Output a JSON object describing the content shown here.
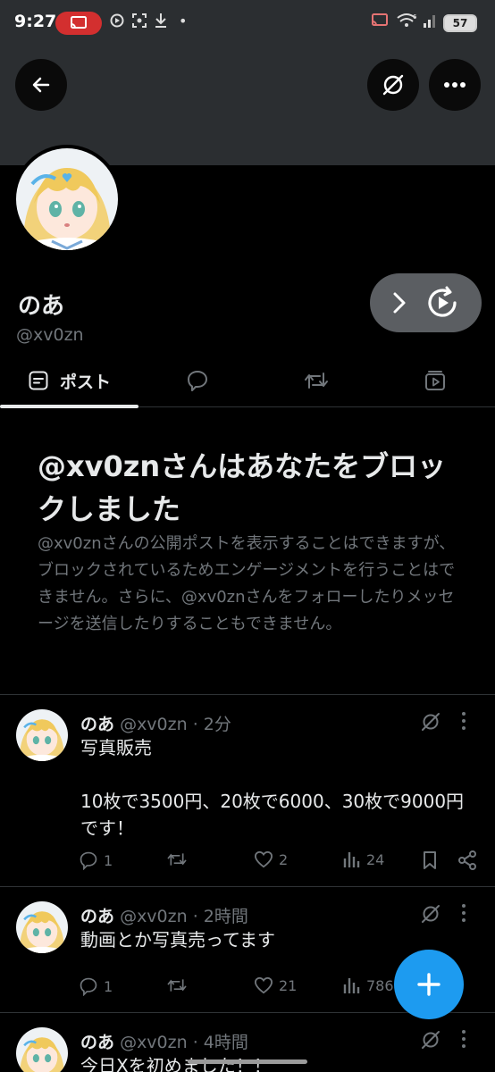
{
  "status_bar": {
    "time": "9:27",
    "battery": "57",
    "network": "6"
  },
  "profile": {
    "display_name": "のあ",
    "handle": "@xv0zn"
  },
  "tabs": [
    {
      "label": "ポスト",
      "icon": "posts-icon",
      "active": true
    },
    {
      "label": "",
      "icon": "reply-icon",
      "active": false
    },
    {
      "label": "",
      "icon": "repost-icon",
      "active": false
    },
    {
      "label": "",
      "icon": "media-icon",
      "active": false
    }
  ],
  "block_notice": {
    "title": "@xv0znさんはあなたをブロックしました",
    "description": "@xv0znさんの公開ポストを表示することはできますが、ブロックされているためエンゲージメントを行うことはできません。さらに、@xv0znさんをフォローしたりメッセージを送信したりすることもできません。"
  },
  "posts": [
    {
      "name": "のあ",
      "meta": "@xv0zn · 2分",
      "text": "写真販売\n\n10枚で3500円、20枚で6000、30枚で9000円です！",
      "replies": "1",
      "reposts": "",
      "likes": "2",
      "views": "24"
    },
    {
      "name": "のあ",
      "meta": "@xv0zn · 2時間",
      "text": "動画とか写真売ってます",
      "replies": "1",
      "reposts": "",
      "likes": "21",
      "views": "786"
    },
    {
      "name": "のあ",
      "meta": "@xv0zn · 4時間",
      "text": "今日Xを初めました！！"
    }
  ],
  "colors": {
    "background": "#000000",
    "banner": "#2b2e31",
    "accent": "#1d9bf0",
    "muted_text": "#71767b",
    "cast_pill": "#d32f2f"
  }
}
